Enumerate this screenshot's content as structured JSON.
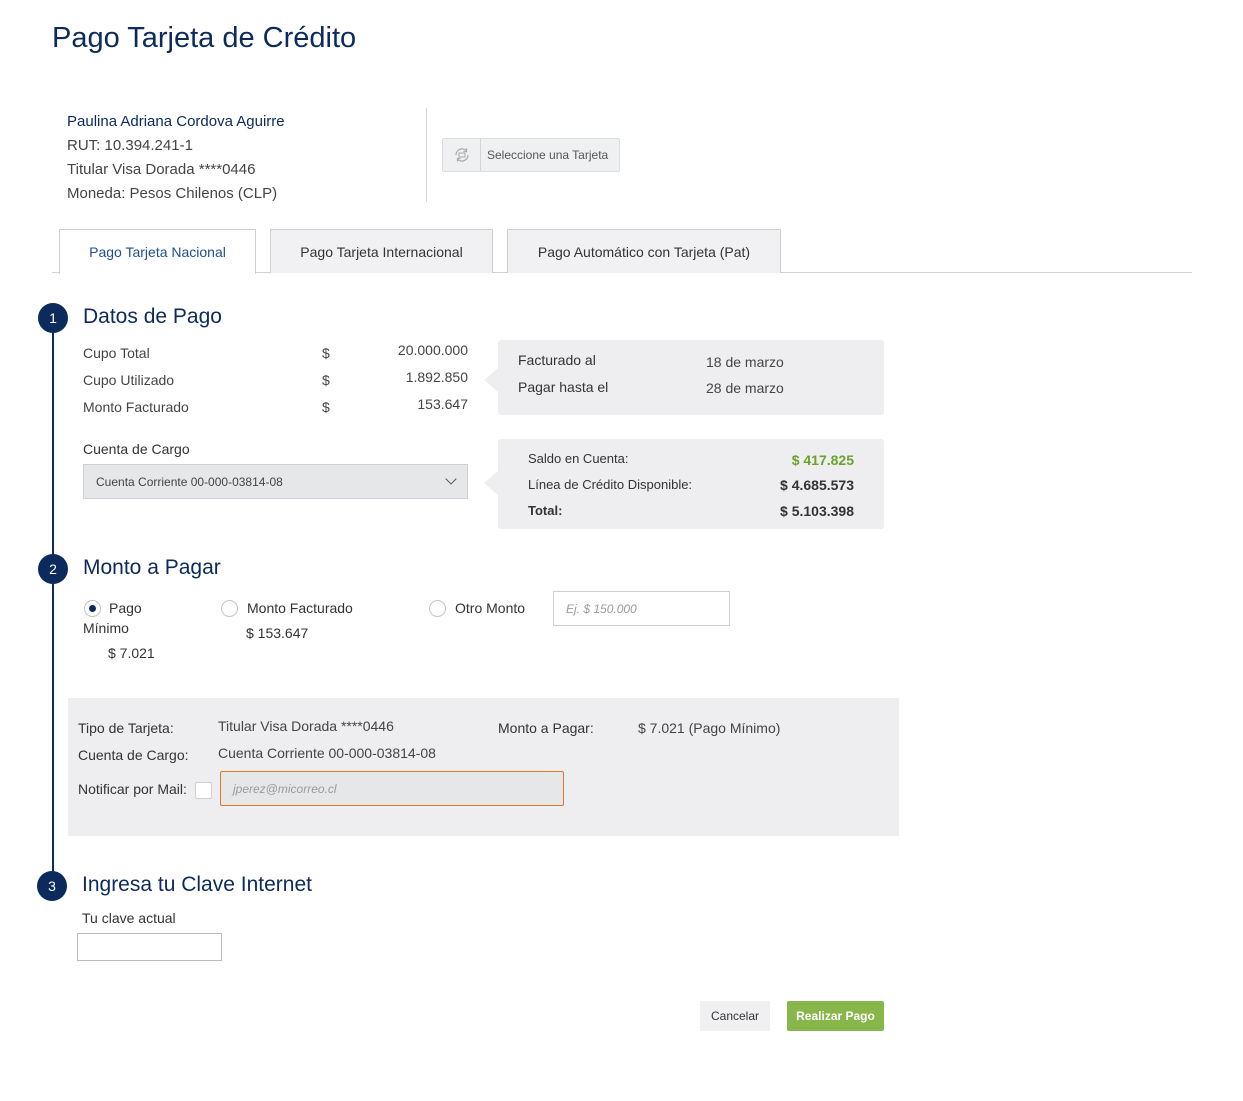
{
  "page_title": "Pago Tarjeta de Crédito",
  "client": {
    "name": "Paulina Adriana Cordova Aguirre",
    "rut": "RUT: 10.394.241-1",
    "card_holder": "Titular Visa Dorada ****0446",
    "currency": "Moneda: Pesos Chilenos (CLP)"
  },
  "select_card_button": "Seleccione una Tarjeta",
  "tabs": [
    {
      "label": "Pago Tarjeta Nacional",
      "active": true
    },
    {
      "label": "Pago Tarjeta Internacional",
      "active": false
    },
    {
      "label": "Pago Automático con Tarjeta (Pat)",
      "active": false
    }
  ],
  "step1": {
    "number": "1",
    "title": "Datos de Pago",
    "rows": [
      {
        "label": "Cupo Total",
        "currency": "$",
        "value": "20.000.000"
      },
      {
        "label": "Cupo Utilizado",
        "currency": "$",
        "value": "1.892.850"
      },
      {
        "label": "Monto Facturado",
        "currency": "$",
        "value": "153.647"
      }
    ],
    "billing_panel": {
      "billed_label": "Facturado al",
      "billed_value": "18 de marzo",
      "due_label": "Pagar hasta el",
      "due_value": "28 de marzo"
    },
    "account_label": "Cuenta de Cargo",
    "account_selected": "Cuenta Corriente 00-000-03814-08",
    "balance_panel": {
      "saldo_label": "Saldo en Cuenta:",
      "saldo_value": "$ 417.825",
      "linea_label": "Línea de Crédito Disponible:",
      "linea_value": "$ 4.685.573",
      "total_label": "Total:",
      "total_value": "$ 5.103.398",
      "saldo_color": "#6aa329"
    }
  },
  "step2": {
    "number": "2",
    "title": "Monto a Pagar",
    "options": {
      "minimo_label_1": "Pago",
      "minimo_label_2": "Mínimo",
      "minimo_value": "$ 7.021",
      "facturado_label": "Monto Facturado",
      "facturado_value": "$ 153.647",
      "otro_label": "Otro Monto",
      "otro_placeholder": "Ej. $ 150.000"
    },
    "selected_option": "minimo"
  },
  "summary": {
    "tipo_label": "Tipo de Tarjeta:",
    "tipo_value": "Titular Visa Dorada ****0446",
    "cuenta_label": "Cuenta de Cargo:",
    "cuenta_value": "Cuenta Corriente 00-000-03814-08",
    "notificar_label": "Notificar por Mail:",
    "email_placeholder": "jperez@micorreo.cl",
    "monto_label": "Monto a Pagar:",
    "monto_value": "$ 7.021 (Pago Mínimo)"
  },
  "step3": {
    "number": "3",
    "title": "Ingresa tu Clave Internet",
    "password_label": "Tu clave actual"
  },
  "actions": {
    "cancel": "Cancelar",
    "submit": "Realizar Pago"
  },
  "colors": {
    "primary": "#0c2a5b",
    "accent_green": "#87b64a",
    "error_border": "#e2762e"
  }
}
